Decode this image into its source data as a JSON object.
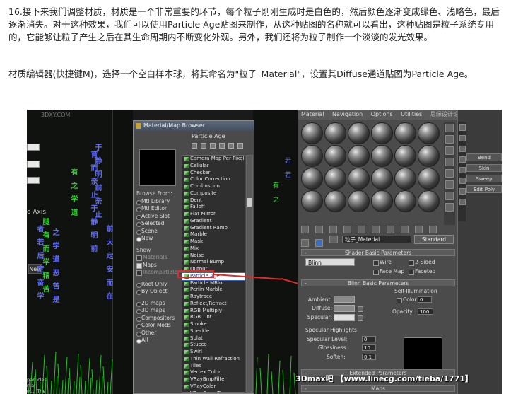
{
  "article": {
    "para1": "16.接下来我们调整材质，材质是一个非常重要的环节，每个粒子刚刚生成时是白色的，然后颜色逐渐变成绿色、浅略色，最后逐渐消失。对于这种效果，我们可以使用Particle Age贴图来制作，从这种贴图的名称就可以看出，这种贴图是粒子系统专用的，它能够让粒子产生之后在其生命周期内不断变化外观。另外，我们还将为粒子制作一个淡淡的发光效果。",
    "para2": "材质编辑器(快捷键M)，选择一个空白样本球，将其命名为\"粒子_Material\"，设置其Diffuse通道贴图为Particle Age。"
  },
  "viewport": {
    "top_mark": "3DXY.COM",
    "axis_label": "o Axis",
    "new_button": "New",
    "bottom_text_1": "particles",
    "bottom_text_2": "n a",
    "bottom_text_3": "ect. The",
    "columns": [
      {
        "chars": "有之学道",
        "color": "#2fd12f"
      },
      {
        "chars": "者若后定奋学",
        "color": "#5e6cff"
      },
      {
        "chars": "之学道恶苦是",
        "color": "#5e6cff"
      },
      {
        "chars": "腿有而学精苦",
        "color": "#2fd12f"
      },
      {
        "chars": "育而亲止于静明前",
        "color": "#5e6cff"
      },
      {
        "chars": "于静明前亲止",
        "color": "#5e6cff"
      },
      {
        "chars": "前大定安而在",
        "color": "#5e6cff"
      }
    ]
  },
  "browser": {
    "title": "Material/Map Browser",
    "name_label": "Particle Age",
    "browse_from_label": "Browse From:",
    "browse_from": [
      {
        "label": "Mtl Library",
        "on": false
      },
      {
        "label": "Mtl Editor",
        "on": false
      },
      {
        "label": "Active Slot",
        "on": false
      },
      {
        "label": "Selected",
        "on": false
      },
      {
        "label": "Scene",
        "on": false
      },
      {
        "label": "New",
        "on": true
      }
    ],
    "show_label": "Show",
    "show": [
      {
        "label": "Materials",
        "on": false
      },
      {
        "label": "Maps",
        "on": true
      },
      {
        "label": "Incompatible",
        "on": false
      }
    ],
    "root": [
      {
        "label": "Root Only",
        "on": false
      },
      {
        "label": "By Object",
        "on": false
      }
    ],
    "types": [
      {
        "label": "2D maps",
        "on": false
      },
      {
        "label": "3D maps",
        "on": false
      },
      {
        "label": "Compositors",
        "on": false
      },
      {
        "label": "Color Mods",
        "on": false
      },
      {
        "label": "Other",
        "on": false
      },
      {
        "label": "All",
        "on": true
      }
    ],
    "list": [
      "Camera Map Per Pixel",
      "Cellular",
      "Checker",
      "Color Correction",
      "Combustion",
      "Composite",
      "Dent",
      "Falloff",
      "Flat Mirror",
      "Gradient",
      "Gradient Ramp",
      "Marble",
      "Mask",
      "Mix",
      "Noise",
      "Normal Bump",
      "Output",
      "Particle Age",
      "Particle MBlur",
      "Perlin Marble",
      "Raytrace",
      "Reflect/Refract",
      "RGB Multiply",
      "RGB Tint",
      "Smoke",
      "Speckle",
      "Splat",
      "Stucco",
      "Swirl",
      "Thin Wall Refraction",
      "Tiles",
      "Vertex Color",
      "VRayBmpFilter",
      "VRayColor",
      "VRayCompTex"
    ],
    "selected_index": 17
  },
  "editor": {
    "menu": [
      "Material",
      "Navigation",
      "Options",
      "Utilities"
    ],
    "menu_overlay": "思缘设计论坛 www.MISSYUAN.COM",
    "material_name": "粒子_Material",
    "material_type": "Standard",
    "shader_rollout": "Shader Basic Parameters",
    "shader": "Blinn",
    "shader_checks": [
      "Wire",
      "2-Sided",
      "Face Map",
      "Faceted"
    ],
    "blinn_rollout": "Blinn Basic Parameters",
    "self_illum": "Self-Illumination",
    "color_label": "Color",
    "color_value": "0",
    "ambient": "Ambient:",
    "diffuse": "Diffuse:",
    "specular": "Specular:",
    "opacity_label": "Opacity:",
    "opacity_value": "100",
    "spec_highlights": "Specular Highlights",
    "spec_level": "Specular Level:",
    "spec_level_value": "0",
    "glossiness": "Glossiness:",
    "glossiness_value": "10",
    "soften": "Soften:",
    "soften_value": "0.1",
    "extended_rollout": "Extended Parameters",
    "maps_rollout": "Maps"
  },
  "right_panel": {
    "buttons": [
      "Bend",
      "Skin",
      "Sweep",
      "Edit Poly"
    ]
  },
  "watermark": "3Dmax吧 【www.linecg.com/tieba/1771】"
}
